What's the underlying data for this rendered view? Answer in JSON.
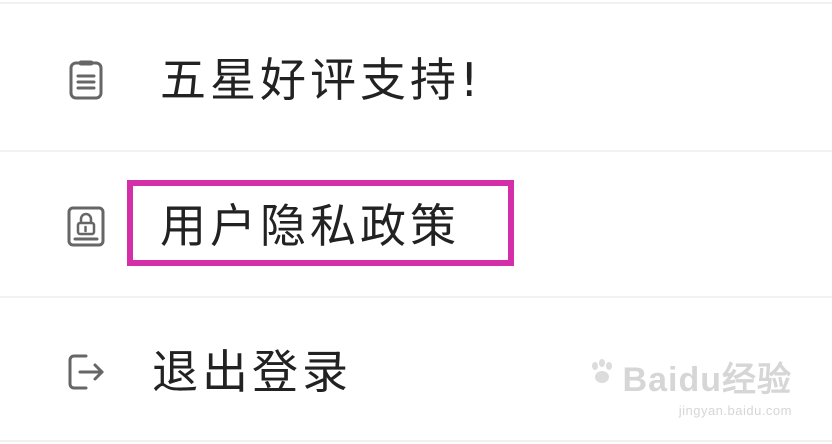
{
  "menu": {
    "items": [
      {
        "icon": "clipboard-list-icon",
        "label": "五星好评支持!"
      },
      {
        "icon": "lock-document-icon",
        "label": "用户隐私政策"
      },
      {
        "icon": "logout-icon",
        "label": "退出登录"
      }
    ]
  },
  "highlight": {
    "color": "#d42ea8"
  },
  "watermark": {
    "brand": "Baidu经验",
    "url": "jingyan.baidu.com"
  }
}
